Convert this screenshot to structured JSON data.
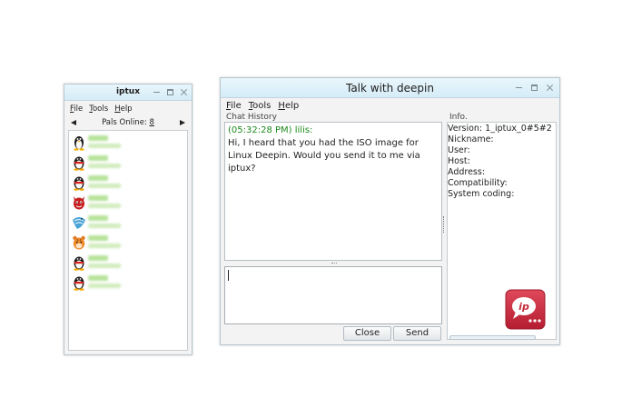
{
  "list_window": {
    "title": "iptux",
    "menu": [
      "File",
      "Tools",
      "Help"
    ],
    "online_label": "Pals Online: ",
    "online_count": "8",
    "pals": [
      {
        "icon": "linux-penguin-icon"
      },
      {
        "icon": "qq-penguin-icon"
      },
      {
        "icon": "qq-penguin-icon"
      },
      {
        "icon": "devil-avatar-icon"
      },
      {
        "icon": "bird-avatar-icon"
      },
      {
        "icon": "tiger-avatar-icon"
      },
      {
        "icon": "qq-penguin-icon"
      },
      {
        "icon": "qq-penguin-icon"
      }
    ]
  },
  "talk_window": {
    "title": "Talk with deepin",
    "menu": [
      "File",
      "Tools",
      "Help"
    ],
    "chat_history_label": "Chat History",
    "messages": [
      {
        "header": "(05:32:28 PM) lilis:",
        "body": "Hi, I heard that you had the ISO image for\nLinux Deepin. Would you send it to me via\niptux?"
      }
    ],
    "input_text": "",
    "buttons": {
      "close": "Close",
      "send": "Send"
    },
    "info": {
      "label": "Info.",
      "lines": [
        "Version: 1_iptux_0#5#2",
        "Nickname:",
        "User:",
        "Host:",
        "Address:",
        "Compatibility:",
        "System coding:"
      ],
      "logo": "iptux-logo-icon"
    }
  },
  "colors": {
    "titlebar": "#d5ecf7",
    "message_header": "#1e8a1e",
    "logo": "#c42a3a"
  }
}
